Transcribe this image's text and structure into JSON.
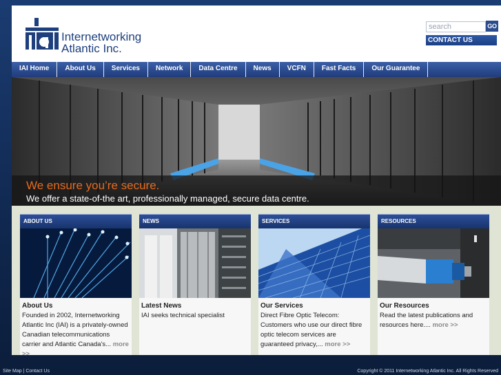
{
  "header": {
    "brand_line1": "Internetworking",
    "brand_line2": "Atlantic Inc.",
    "logo_text": "iai",
    "search_placeholder": "search",
    "go_label": "GO",
    "contact_label": "CONTACT US"
  },
  "nav": {
    "items": [
      "IAI Home",
      "About Us",
      "Services",
      "Network",
      "Data Centre",
      "News",
      "VCFN",
      "Fast Facts",
      "Our Guarantee"
    ]
  },
  "hero": {
    "headline": "We ensure you’re secure.",
    "subline": "We offer a state-of-the art, professionally managed, secure data centre."
  },
  "panels": [
    {
      "header": "ABOUT US",
      "title": "About Us",
      "text": "Founded in 2002, Internetworking Atlantic Inc (IAI) is a privately-owned Canadian telecommunications carrier and Atlantic Canada's...",
      "more": "more >>",
      "image": "fiber-optic-image"
    },
    {
      "header": "NEWS",
      "title": "Latest News",
      "text": "IAI seeks technical specialist",
      "more": "",
      "image": "server-room-image"
    },
    {
      "header": "SERVICES",
      "title": "Our Services",
      "text": "Direct Fibre Optic Telecom: Customers who use our direct fibre optic telecom services are guaranteed privacy,...",
      "more": "more >>",
      "image": "glass-building-image"
    },
    {
      "header": "RESOURCES",
      "title": "Our Resources",
      "text": "Read the latest publications and resources here....",
      "more": "more >>",
      "image": "network-cable-image"
    }
  ],
  "footer": {
    "left": "Site Map | Contact Us",
    "right": "Copyright © 2011 Internetworking Atlantic Inc. All Rights Reserved"
  },
  "colors": {
    "brand_blue": "#1d3f7d",
    "nav_blue": "#2a4b8e",
    "hero_accent": "#e86a1c",
    "content_bg": "#dfe4d4"
  }
}
